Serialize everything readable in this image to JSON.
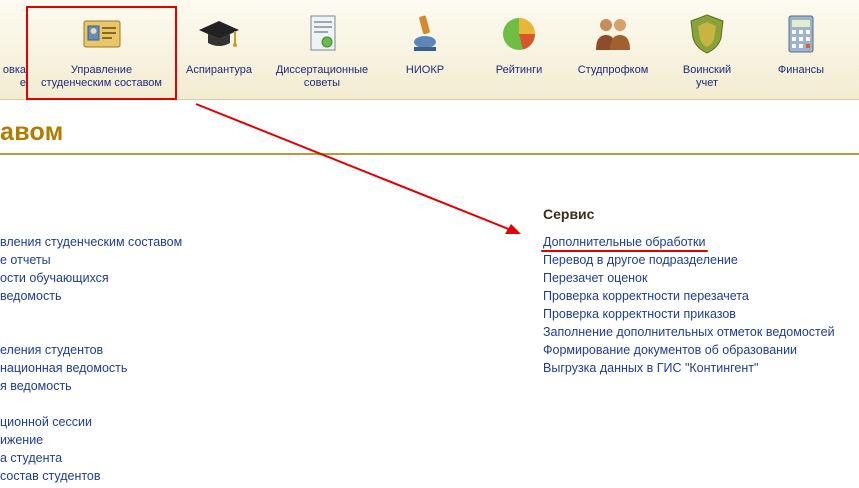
{
  "toolbar": {
    "items": [
      {
        "label": "овка\nе",
        "icon": "partial-icon"
      },
      {
        "label": "Управление\nстуденческим составом",
        "icon": "student-id-card-icon"
      },
      {
        "label": "Аспирантура",
        "icon": "graduation-cap-icon"
      },
      {
        "label": "Диссертационные\nсоветы",
        "icon": "certificate-document-icon"
      },
      {
        "label": "НИОКР",
        "icon": "microscope-icon"
      },
      {
        "label": "Рейтинги",
        "icon": "pie-chart-icon"
      },
      {
        "label": "Студпрофком",
        "icon": "people-group-icon"
      },
      {
        "label": "Воинский\nучет",
        "icon": "shield-icon"
      },
      {
        "label": "Финансы",
        "icon": "calculator-icon"
      }
    ]
  },
  "page": {
    "title": "авом"
  },
  "left_groups": [
    [
      "вления студенческим составом",
      "е отчеты",
      "ости обучающихся",
      "ведомость"
    ],
    [
      "еления студентов",
      "национная ведомость",
      "я ведомость"
    ],
    [
      "ционной сессии",
      "ижение",
      "а студента",
      "состав студентов"
    ]
  ],
  "service": {
    "heading": "Сервис",
    "links": [
      "Дополнительные обработки",
      "Перевод в другое подразделение",
      "Перезачет оценок",
      "Проверка корректности перезачета",
      "Проверка корректности приказов",
      "Заполнение дополнительных отметок ведомостей",
      "Формирование документов об образовании",
      "Выгрузка данных в ГИС \"Контингент\""
    ]
  },
  "colors": {
    "annotation": "#e30000",
    "title": "#b07c00",
    "link": "#1f3c99"
  }
}
